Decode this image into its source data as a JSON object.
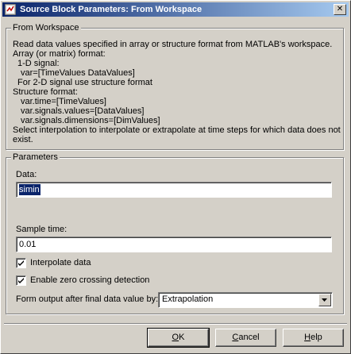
{
  "window": {
    "title": "Source Block Parameters: From Workspace",
    "icon": "simulink-block-icon",
    "close_glyph": "✕"
  },
  "description": {
    "legend": "From Workspace",
    "lines": [
      "Read data values specified in array or structure format from MATLAB's workspace.",
      "Array (or matrix) format:",
      "1-D signal:",
      "var=[TimeValues DataValues]",
      "For 2-D signal use structure format",
      "Structure format:",
      "var.time=[TimeValues]",
      "var.signals.values=[DataValues]",
      "var.signals.dimensions=[DimValues]",
      "Select interpolation to interpolate or extrapolate at time steps for which data does not",
      "exist."
    ]
  },
  "parameters": {
    "legend": "Parameters",
    "data_label": "Data:",
    "data_value": "simin",
    "sample_time_label": "Sample time:",
    "sample_time_value": "0.01",
    "interpolate_label": "Interpolate data",
    "interpolate_checked": true,
    "zero_crossing_label": "Enable zero crossing detection",
    "zero_crossing_checked": true,
    "form_output_label": "Form output after final data value by:",
    "form_output_value": "Extrapolation"
  },
  "buttons": {
    "ok_hotkey": "O",
    "ok_rest": "K",
    "cancel_hotkey": "C",
    "cancel_rest": "ancel",
    "help_hotkey": "H",
    "help_rest": "elp"
  },
  "colors": {
    "titlebar_start": "#0a246a",
    "titlebar_end": "#a6caf0",
    "face": "#d4d0c8",
    "selection": "#0a246a"
  }
}
